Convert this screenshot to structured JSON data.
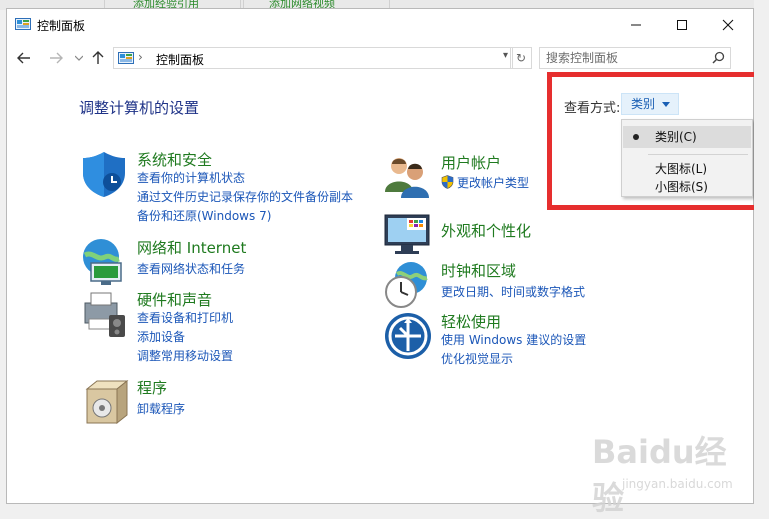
{
  "background_tabs": [
    "添加经验引用",
    "添加网络视频"
  ],
  "window": {
    "title": "控制面板"
  },
  "titlebar_buttons": {
    "minimize": "—",
    "maximize": "☐",
    "close": "✕"
  },
  "nav": {
    "back_icon": "left-arrow-icon",
    "forward_icon": "right-arrow-icon",
    "history_icon": "chevron-down-icon",
    "up_icon": "up-arrow-icon"
  },
  "address": {
    "separator": "›",
    "text": "控制面板",
    "dropdown": "▾",
    "refresh": "↻"
  },
  "search": {
    "placeholder": "搜索控制面板"
  },
  "main": {
    "heading": "调整计算机的设置",
    "viewby_label": "查看方式:",
    "viewby_value": "类别"
  },
  "dropdown": {
    "items": [
      {
        "label": "类别(C)",
        "selected": true
      },
      {
        "label": "大图标(L)",
        "selected": false
      },
      {
        "label": "小图标(S)",
        "selected": false
      }
    ]
  },
  "categories": {
    "system": {
      "title": "系统和安全",
      "links": [
        "查看你的计算机状态",
        "通过文件历史记录保存你的文件备份副本",
        "备份和还原(Windows 7)"
      ]
    },
    "network": {
      "title": "网络和 Internet",
      "links": [
        "查看网络状态和任务"
      ]
    },
    "hardware": {
      "title": "硬件和声音",
      "links": [
        "查看设备和打印机",
        "添加设备",
        "调整常用移动设置"
      ]
    },
    "programs": {
      "title": "程序",
      "links": [
        "卸载程序"
      ]
    },
    "user": {
      "title": "用户帐户",
      "links": [
        "更改帐户类型"
      ]
    },
    "appearance": {
      "title": "外观和个性化",
      "links": []
    },
    "clock": {
      "title": "时钟和区域",
      "links": [
        "更改日期、时间或数字格式"
      ]
    },
    "ease": {
      "title": "轻松使用",
      "links": [
        "使用 Windows 建议的设置",
        "优化视觉显示"
      ]
    }
  },
  "watermark": {
    "text": "Baidu经验",
    "url": "jingyan.baidu.com"
  },
  "colors": {
    "link": "#1c57b8",
    "category_title": "#1f7a1f",
    "heading": "#1e3287",
    "highlight_box": "#e62e2e"
  }
}
